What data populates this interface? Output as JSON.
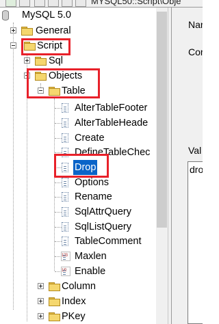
{
  "title_path": "MYSQL50::Script\\Obje",
  "tree": {
    "root": "MySQL 5.0",
    "general": "General",
    "script": "Script",
    "sql": "Sql",
    "objects": "Objects",
    "table": "Table",
    "leaves": [
      "AlterTableFooter",
      "AlterTableHeade",
      "Create",
      "DefineTableChec",
      "Drop",
      "Options",
      "Rename",
      "SqlAttrQuery",
      "SqlListQuery",
      "TableComment",
      "Maxlen",
      "Enable"
    ],
    "leaf_icon_text": [
      "",
      "",
      "",
      "",
      "",
      "",
      "",
      "",
      "",
      "",
      "123",
      "1/0"
    ],
    "after": [
      "Column",
      "Index",
      "PKey"
    ]
  },
  "right_pane": {
    "name_label": "Nar",
    "comment_label": "Cor",
    "value_label": "Val",
    "value_text": "dro"
  },
  "colors": {
    "selection": "#0a64c8",
    "highlight": "#e8212a"
  }
}
